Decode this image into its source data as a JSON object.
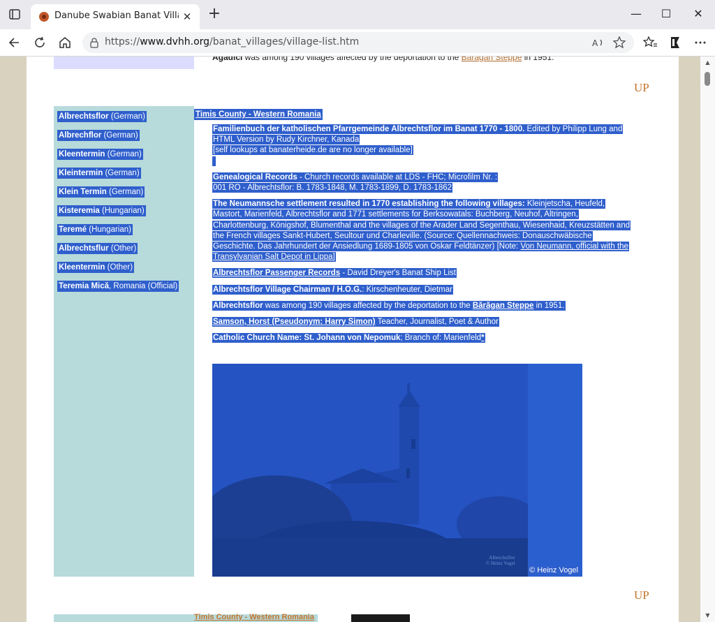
{
  "browser": {
    "tab_title": "Danube Swabian Banat Village List",
    "close_glyph": "✕",
    "new_tab_glyph": "+",
    "url_prefix": "https://",
    "url_domain": "www.dvhh.org",
    "url_path": "/banat_villages/village-list.htm",
    "window_buttons": [
      "—",
      "☐",
      "✕"
    ]
  },
  "top_partial": {
    "village": "Agadici",
    "text": " was among 190 villages affected by the deportation to the ",
    "link": "Bărăgan Steppe",
    "suffix": " in 1951."
  },
  "up_label": "UP",
  "names": [
    {
      "name": "Albrechtsflor",
      "lang": " (German)"
    },
    {
      "name": "Albrechflor",
      "lang": " (German)"
    },
    {
      "name": "Kleentermin",
      "lang": " (German)"
    },
    {
      "name": "Kleintermin",
      "lang": " (German)"
    },
    {
      "name": "Klein Termin",
      "lang": " (German)"
    },
    {
      "name": "Kisteremia",
      "lang": " (Hungarian)"
    },
    {
      "name": "Teremé",
      "lang": " (Hungarian)"
    },
    {
      "name": "Albrechtsflur",
      "lang": " (Other)"
    },
    {
      "name": "Kleentermin",
      "lang": " (Other)"
    },
    {
      "name": "Teremia Mică",
      "lang": ", Romania (Official)"
    }
  ],
  "county": "Timis County - Western Romania",
  "info": {
    "familienbuch_bold": "Familienbuch der katholischen Pfarrgemeinde Albrechtsflor im Banat 1770 - 1800.",
    "familienbuch_rest": " Edited by Philipp Lung and HTML Version by Rudy Kirchner, Kanada",
    "self_lookups": "[self lookups at banaterheide.de are no longer available]",
    "genealogical_bold": "Genealogical Records",
    "genealogical_rest": " - Church records available at LDS - FHC; Microfilm Nr. :",
    "genealogical_line2": "001 RO - Albrechtsflor: B. 1783-1848, M. 1783-1899, D. 1783-1862",
    "neumann_bold": "The Neumannsche settlement resulted in 1770 establishing the following villages:",
    "neumann_rest": " Kleinjetscha, Heufeld, Mastort, Marienfeld, Albrechtsflor and 1771 settlements for Berksowatals: Buchberg, Neuhof, Altringen, Charlottenburg, Königshof, Blumenthal and the villages of the Arader Land Segenthau, Wiesenhaid, Kreuzstätten and the French villages Sankt-Hubert, Seultour und Charleville. (Source: Quellennachweis: Donauschwäbische Geschichte. Das Jahrhundert der Ansiedlung 1689-1805 von Oskar Feldtänzer) [Note: ",
    "neumann_link": "Von Neumann, official with the Transylvanian Salt Depot in Lippa",
    "neumann_end": "]",
    "passenger_link": "Albrechtsflor Passenger Records",
    "passenger_rest": " - David Dreyer's Banat Ship List",
    "chairman_bold": "Albrechtsflor Village Chairman / H.O.G.",
    "chairman_rest": ": Kirschenheuter, Dietmar",
    "deport_bold": "Albrechtsflor",
    "deport_rest": " was among 190 villages affected by the deportation to the ",
    "deport_link": "Bărăgan Steppe",
    "deport_end": " in 1951.",
    "samson_link": "Samson, Horst (Pseudonym: Harry Simon)",
    "samson_rest": " Teacher, Journalist, Poet & Author",
    "church_bold": "Catholic Church Name: St. Johann von Nepomuk",
    "church_rest": "; Branch of: Marienfeld",
    "church_link": "*"
  },
  "photo": {
    "caption": "© Heinz Vogel",
    "watermark": "Albrechtsflor\n© Heinz Vogel"
  },
  "bottom_county": "Timis County - Western Romania"
}
